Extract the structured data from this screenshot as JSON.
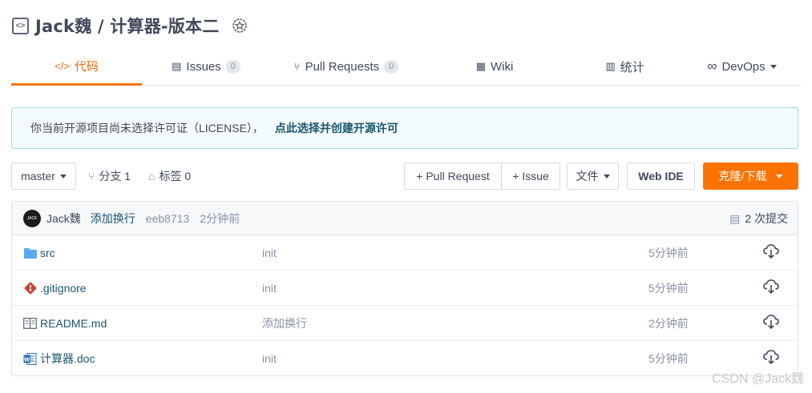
{
  "repo": {
    "title": "Jack魏 / 计算器-版本二",
    "icon": "code-box-icon",
    "badge_icon": "award-badge-icon"
  },
  "tabs": [
    {
      "label": "代码",
      "icon": "</>",
      "icon_name": "code-icon",
      "active": true
    },
    {
      "label": "Issues",
      "icon": "▤",
      "icon_name": "issues-icon",
      "count": "0"
    },
    {
      "label": "Pull Requests",
      "icon": "⑂",
      "icon_name": "pull-request-icon",
      "count": "0"
    },
    {
      "label": "Wiki",
      "icon": "▦",
      "icon_name": "wiki-icon"
    },
    {
      "label": "统计",
      "icon": "▥",
      "icon_name": "stats-icon"
    },
    {
      "label": "DevOps",
      "icon": "∞",
      "icon_name": "devops-icon"
    }
  ],
  "notice": {
    "text": "你当前开源项目尚未选择许可证（LICENSE），",
    "link": "点此选择并创建开源许可"
  },
  "toolbar": {
    "branch": "master",
    "branches_label": "分支 1",
    "tags_label": "标签 0",
    "pull_request_label": "+ Pull Request",
    "issue_label": "+ Issue",
    "file_label": "文件",
    "web_ide_label": "Web IDE",
    "clone_label": "克隆/下载"
  },
  "commit": {
    "author": "Jack魏",
    "message": "添加换行",
    "sha": "eeb8713",
    "time": "2分钟前",
    "count_label": "2 次提交"
  },
  "files": [
    {
      "name": "src",
      "message": "init",
      "time": "5分钟前",
      "icon": "folder-icon"
    },
    {
      "name": ".gitignore",
      "message": "init",
      "time": "5分钟前",
      "icon": "git-icon"
    },
    {
      "name": "README.md",
      "message": "添加换行",
      "time": "2分钟前",
      "icon": "readme-icon"
    },
    {
      "name": "计算器.doc",
      "message": "init",
      "time": "5分钟前",
      "icon": "word-doc-icon"
    }
  ],
  "watermark": "CSDN @Jack魏",
  "colors": {
    "accent": "#fe7300",
    "link": "#1b5570",
    "notice_bg": "#f3fbfc",
    "notice_border": "#a9d8de"
  }
}
